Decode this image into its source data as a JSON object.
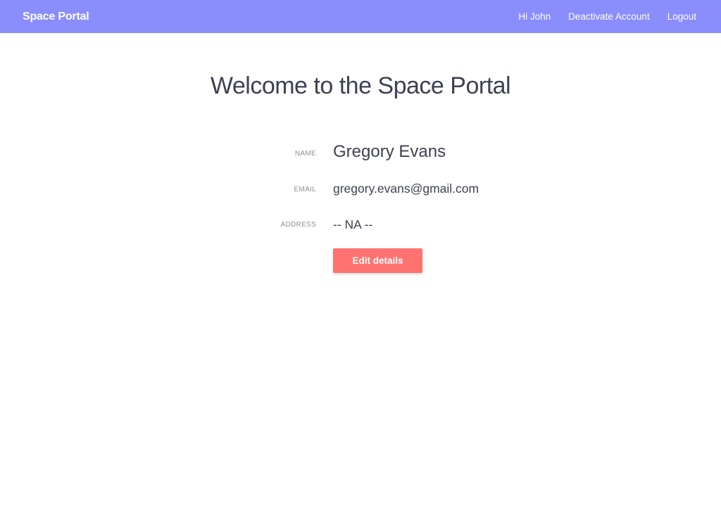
{
  "navbar": {
    "brand": "Space Portal",
    "links": [
      {
        "label": "Hi John"
      },
      {
        "label": "Deactivate Account"
      },
      {
        "label": "Logout"
      }
    ],
    "background_color": "#8a8dfc"
  },
  "main": {
    "title": "Welcome to the Space Portal",
    "details": {
      "name": {
        "label": "NAME",
        "value": "Gregory Evans"
      },
      "email": {
        "label": "EMAIL",
        "value": "gregory.evans@gmail.com"
      },
      "address": {
        "label": "ADDRESS",
        "value": "-- NA --"
      }
    },
    "edit_button": {
      "label": "Edit details",
      "color": "#ff7270"
    }
  }
}
